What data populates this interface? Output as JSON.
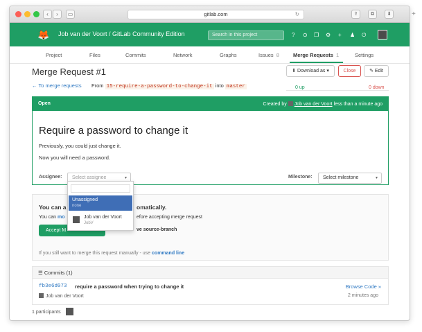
{
  "browser": {
    "url": "gitlab.com",
    "back": "‹",
    "forward": "›",
    "sidebar": "▭",
    "refresh": "↻",
    "share": "⇪",
    "tabs": "⧉",
    "download": "⬇",
    "newtab": "+"
  },
  "header": {
    "title": "Job van der Voort / GitLab Community Edition",
    "search_placeholder": "Search in this project",
    "logo": "🦊",
    "icons": [
      "?",
      "⊙",
      "❐",
      "⚙",
      "+",
      "♟",
      "⏻"
    ],
    "accent": "#1f9e64"
  },
  "subnav": {
    "items": [
      {
        "label": "Project"
      },
      {
        "label": "Files"
      },
      {
        "label": "Commits"
      },
      {
        "label": "Network"
      },
      {
        "label": "Graphs"
      },
      {
        "label": "Issues",
        "count": "8"
      },
      {
        "label": "Merge Requests",
        "count": "1",
        "active": true
      },
      {
        "label": "Settings"
      }
    ]
  },
  "mr": {
    "title": "Merge Request #1",
    "download_label": "Download as",
    "close_label": "Close",
    "edit_label": "Edit",
    "back_label": "To merge requests",
    "from_label": "From",
    "source_branch": "15-require-a-password-to-change-it",
    "into_label": "into",
    "target_branch": "master",
    "up": "0 up",
    "down": "0 down",
    "state": "Open",
    "created_prefix": "Created by",
    "author": "Job van der Voort",
    "created_suffix": "less than a minute ago",
    "heading": "Require a password to change it",
    "desc1": "Previously, you could just change it.",
    "desc2": "Now you will need a password.",
    "assignee_label": "Assignee:",
    "assignee_placeholder": "Select assignee",
    "milestone_label": "Milestone:",
    "milestone_placeholder": "Select milestone"
  },
  "dropdown": {
    "selected_name": "Unassigned",
    "selected_sub": "none",
    "user_name": "Job van der Voort",
    "user_handle": "JobV"
  },
  "merge": {
    "title_a": "You can a",
    "title_b": "omatically.",
    "line_a": "You can",
    "line_a_link": "mo",
    "line_b": "efore accepting merge request",
    "accept_label": "Accept M",
    "remove_label": "ve source-branch",
    "manual_prefix": "If you still want to merge this request manually - use",
    "manual_link": "command line"
  },
  "commits": {
    "header": "Commits (1)",
    "sha": "fb3e6d073",
    "message": "require a password when trying to change it",
    "author": "Job van der Voort",
    "browse_label": "Browse Code »",
    "ago": "2 minutes ago"
  },
  "participants": {
    "label": "1 participants"
  }
}
